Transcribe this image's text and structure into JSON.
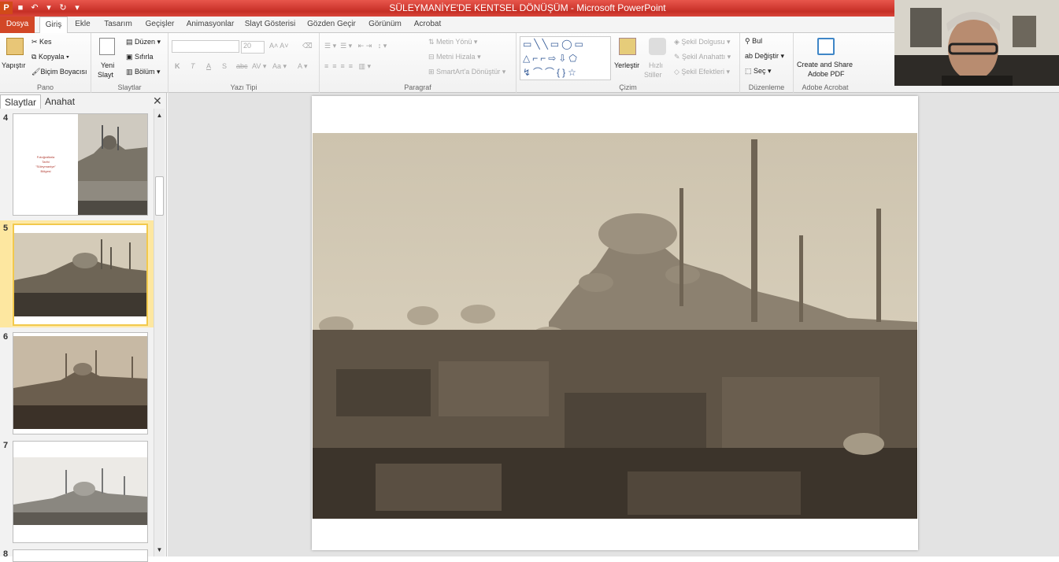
{
  "window": {
    "title": "SÜLEYMANİYE'DE KENTSEL DÖNÜŞÜM  -  Microsoft PowerPoint"
  },
  "tabs": [
    "Dosya",
    "Giriş",
    "Ekle",
    "Tasarım",
    "Geçişler",
    "Animasyonlar",
    "Slayt Gösterisi",
    "Gözden Geçir",
    "Görünüm",
    "Acrobat"
  ],
  "ribbon": {
    "pano": {
      "label": "Pano",
      "paste": "Yapıştır",
      "cut": "Kes",
      "copy": "Kopyala",
      "painter": "Biçim Boyacısı"
    },
    "slaytlar": {
      "label": "Slaytlar",
      "new_slide_1": "Yeni",
      "new_slide_2": "Slayt",
      "layout": "Düzen",
      "reset": "Sıfırla",
      "section": "Bölüm"
    },
    "yazi_tipi": {
      "label": "Yazı Tipi",
      "font_size": "20",
      "bold": "K",
      "italic": "T",
      "underline": "A",
      "shadow": "S",
      "strike": "abc"
    },
    "paragraf": {
      "label": "Paragraf",
      "text_dir": "Metin Yönü",
      "align_text": "Metni Hizala",
      "smartart": "SmartArt'a Dönüştür"
    },
    "cizim": {
      "label": "Çizim",
      "arrange_1": "Yerleştir",
      "quick_1": "Hızlı",
      "quick_2": "Stiller",
      "fill": "Şekil Dolgusu",
      "outline": "Şekil Anahattı",
      "effects": "Şekil Efektleri"
    },
    "duzenleme": {
      "label": "Düzenleme",
      "find": "Bul",
      "replace": "Değiştir",
      "select": "Seç"
    },
    "acrobat": {
      "label": "Adobe Acrobat",
      "create_1": "Create and Share",
      "create_2": "Adobe PDF"
    }
  },
  "panel": {
    "tabs": [
      "Slaytlar",
      "Anahat"
    ],
    "slides": [
      {
        "num": "4",
        "caption": [
          "Fotoğraflarla",
          "Tarihi",
          "\"Süleymaniye\"",
          "Bölgesi"
        ]
      },
      {
        "num": "5"
      },
      {
        "num": "6"
      },
      {
        "num": "7"
      },
      {
        "num": "8"
      }
    ]
  },
  "colors": {
    "accent": "#d24726",
    "selection": "#f2c94c",
    "titlebar": "#d0392f"
  }
}
